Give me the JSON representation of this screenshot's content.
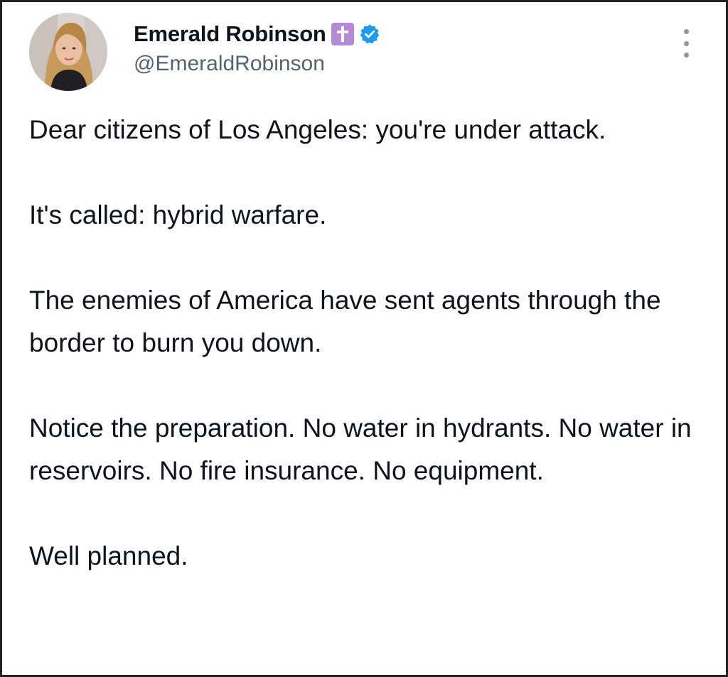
{
  "author": {
    "display_name": "Emerald Robinson",
    "handle": "@EmeraldRobinson",
    "badge_icons": [
      "cross-emoji-icon",
      "verified-badge-icon"
    ]
  },
  "colors": {
    "text": "#0f1419",
    "handle": "#536471",
    "verified": "#1d9bf0",
    "cross_badge": "#b48ad6"
  },
  "tweet": {
    "paragraphs": [
      "Dear citizens of Los Angeles: you're under attack.",
      "It's called: hybrid warfare.",
      "The enemies of America have sent agents through the border to burn you down.",
      "Notice the preparation. No water in hydrants. No water in reservoirs. No fire insurance. No equipment.",
      "Well planned."
    ]
  }
}
